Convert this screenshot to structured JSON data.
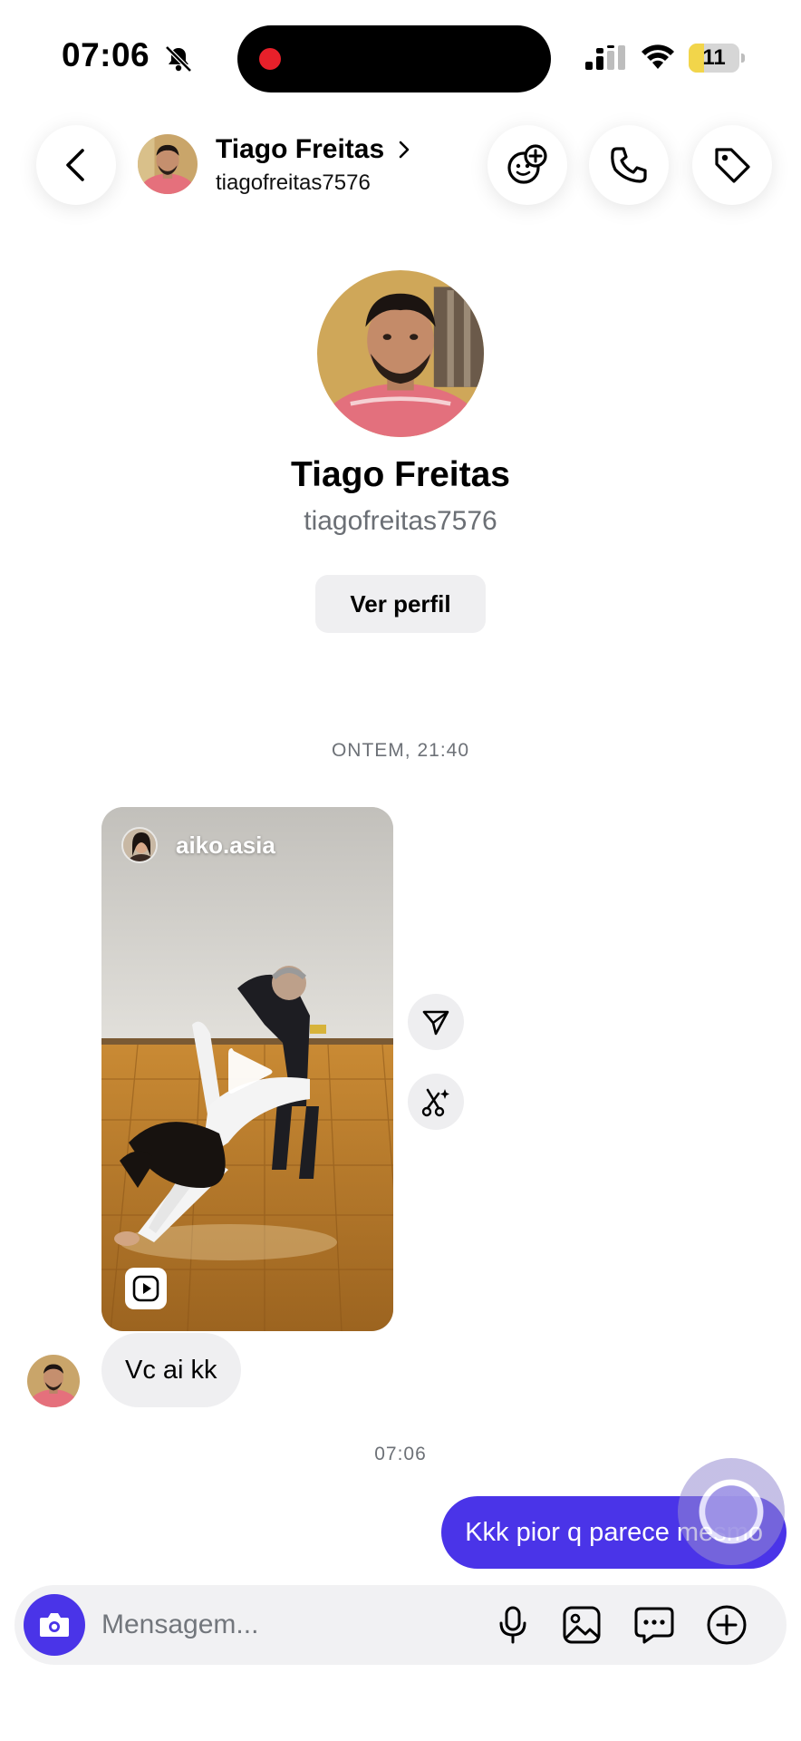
{
  "status_bar": {
    "time": "07:06",
    "battery_level": "11",
    "icons": [
      "bell-slash-icon",
      "signal-icon",
      "wifi-icon",
      "battery-icon"
    ]
  },
  "header": {
    "name": "Tiago Freitas",
    "username": "tiagofreitas7576",
    "icons": [
      "back-arrow-icon",
      "chevron-right-icon",
      "effects-icon",
      "phone-icon",
      "tag-icon"
    ]
  },
  "profile": {
    "name": "Tiago Freitas",
    "username": "tiagofreitas7576",
    "view_profile_label": "Ver perfil"
  },
  "thread": {
    "timestamp_1": "ONTEM, 21:40",
    "shared_reel": {
      "author": "aiko.asia",
      "icons": [
        "play-icon",
        "reel-icon",
        "share-icon",
        "remix-icon"
      ]
    },
    "incoming_message": "Vc ai kk",
    "timestamp_2": "07:06",
    "outgoing_message": "Kkk pior q parece mesmo"
  },
  "composer": {
    "placeholder": "Mensagem...",
    "icons": [
      "camera-icon",
      "microphone-icon",
      "gallery-icon",
      "sticker-icon",
      "plus-icon"
    ]
  },
  "colors": {
    "accent": "#4a34e8",
    "bubble_incoming": "#efeff1",
    "muted_text": "#6d7177",
    "battery_low": "#f2d54a"
  }
}
